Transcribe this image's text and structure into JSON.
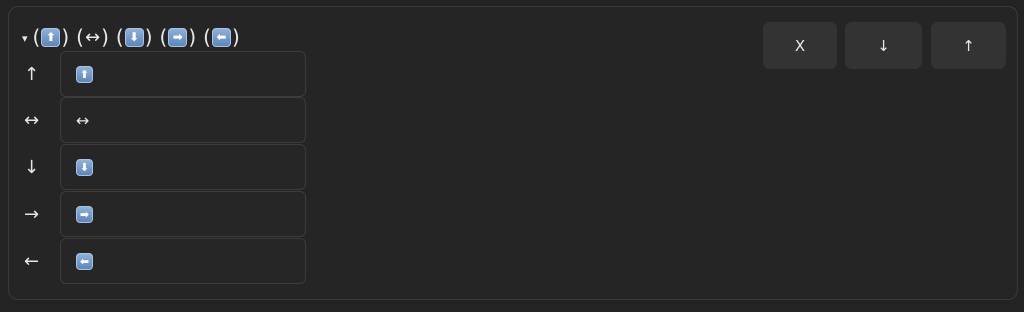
{
  "header": {
    "toggle": "▾",
    "open_paren": "(",
    "close_paren": ")",
    "symbols": [
      {
        "glyph": "⬆",
        "style": "key",
        "icon": "up-arrow-key-icon"
      },
      {
        "glyph": "↔",
        "style": "plain",
        "icon": "left-right-arrow-icon"
      },
      {
        "glyph": "⬇",
        "style": "key",
        "icon": "down-arrow-key-icon"
      },
      {
        "glyph": "➡",
        "style": "key",
        "icon": "right-arrow-key-icon"
      },
      {
        "glyph": "⬅",
        "style": "key",
        "icon": "left-arrow-key-icon"
      }
    ]
  },
  "rows": [
    {
      "label": "↑",
      "value": "⬆",
      "style": "key"
    },
    {
      "label": "↔",
      "value": "↔",
      "style": "plain"
    },
    {
      "label": "↓",
      "value": "⬇",
      "style": "key"
    },
    {
      "label": "→",
      "value": "➡",
      "style": "key"
    },
    {
      "label": "←",
      "value": "⬅",
      "style": "key"
    }
  ],
  "buttons": {
    "close": "X",
    "move_down": "↓",
    "move_up": "↑"
  },
  "colors": {
    "background": "#232323",
    "panel_border": "#3a3a3a",
    "button_bg": "#333333",
    "key_blue": "#6f97c9"
  }
}
